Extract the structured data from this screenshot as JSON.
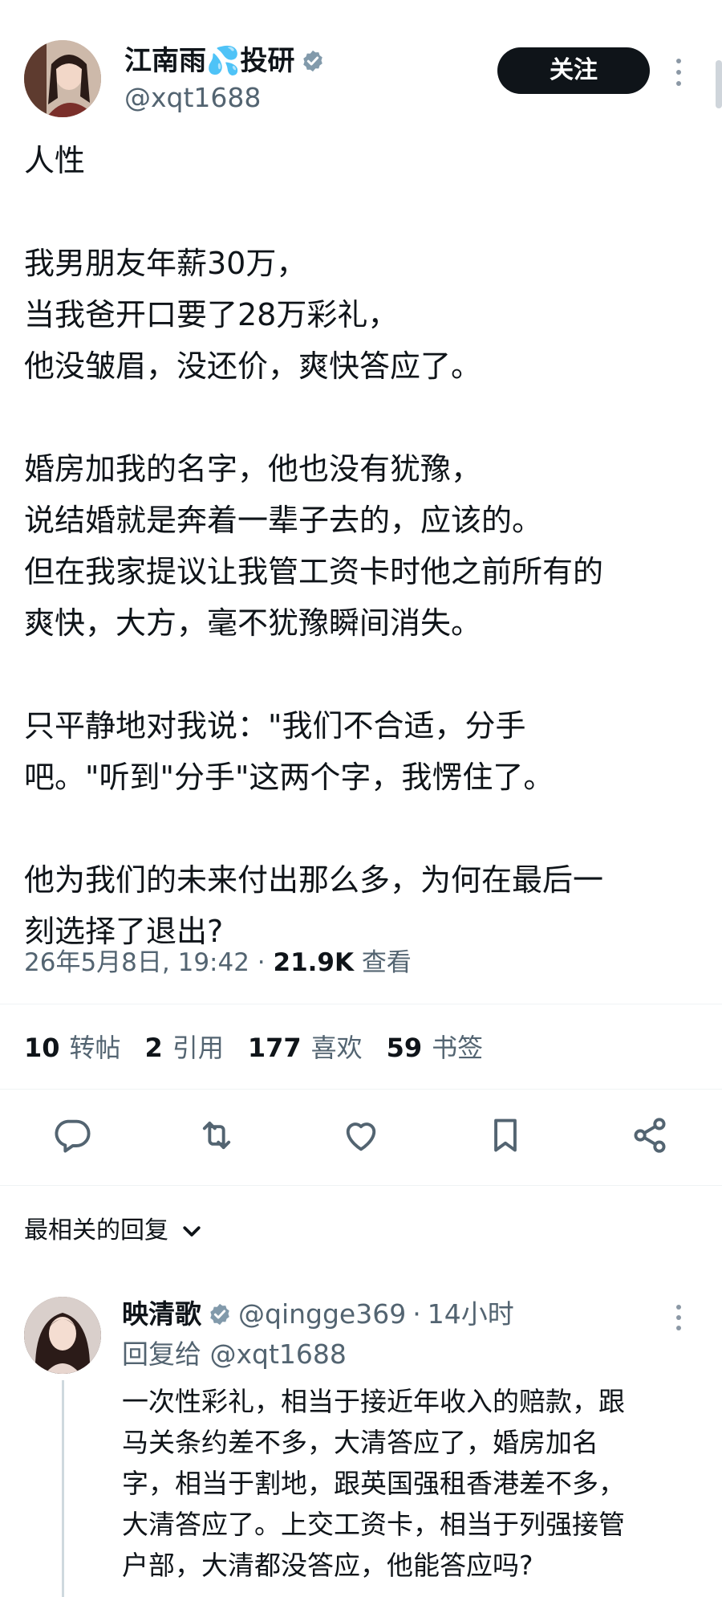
{
  "author": {
    "display_name": "江南雨💦投研",
    "handle": "@xqt1688",
    "verified": true,
    "follow_label": "关注"
  },
  "post": {
    "text": "人性\n\n我男朋友年薪30万，\n当我爸开口要了28万彩礼，\n他没皱眉，没还价，爽快答应了。\n\n婚房加我的名字，他也没有犹豫，\n说结婚就是奔着一辈子去的，应该的。\n但在我家提议让我管工资卡时他之前所有的\n爽快，大方，毫不犹豫瞬间消失。\n\n只平静地对我说：\"我们不合适，分手\n吧。\"听到\"分手\"这两个字，我愣住了。\n\n他为我们的未来付出那么多，为何在最后一\n刻选择了退出?",
    "timestamp": "26年5月8日, 19:42 · ",
    "views_count": "21.9K",
    "views_label": " 查看"
  },
  "stats": {
    "reposts_count": "10",
    "reposts_label": "转帖",
    "quotes_count": "2",
    "quotes_label": "引用",
    "likes_count": "177",
    "likes_label": "喜欢",
    "bookmarks_count": "59",
    "bookmarks_label": "书签"
  },
  "actions": {
    "icons": [
      "reply-icon",
      "retweet-icon",
      "like-icon",
      "bookmark-icon",
      "share-icon"
    ]
  },
  "replies_section": {
    "sort_label": "最相关的回复"
  },
  "reply": {
    "display_name": "映清歌",
    "verified": true,
    "handle": "@qingge369",
    "dot": "·",
    "time": "14小时",
    "replying_to": "回复给 @xqt1688",
    "text": "一次性彩礼，相当于接近年收入的赔款，跟\n马关条约差不多，大清答应了，婚房加名\n字，相当于割地，跟英国强租香港差不多，\n大清答应了。上交工资卡，相当于列强接管\n户部，大清都没答应，他能答应吗?"
  },
  "colors": {
    "text_primary": "#0f1419",
    "text_secondary": "#536471",
    "verified_blue": "#1d9bf0",
    "button_dark": "#0f1419"
  }
}
